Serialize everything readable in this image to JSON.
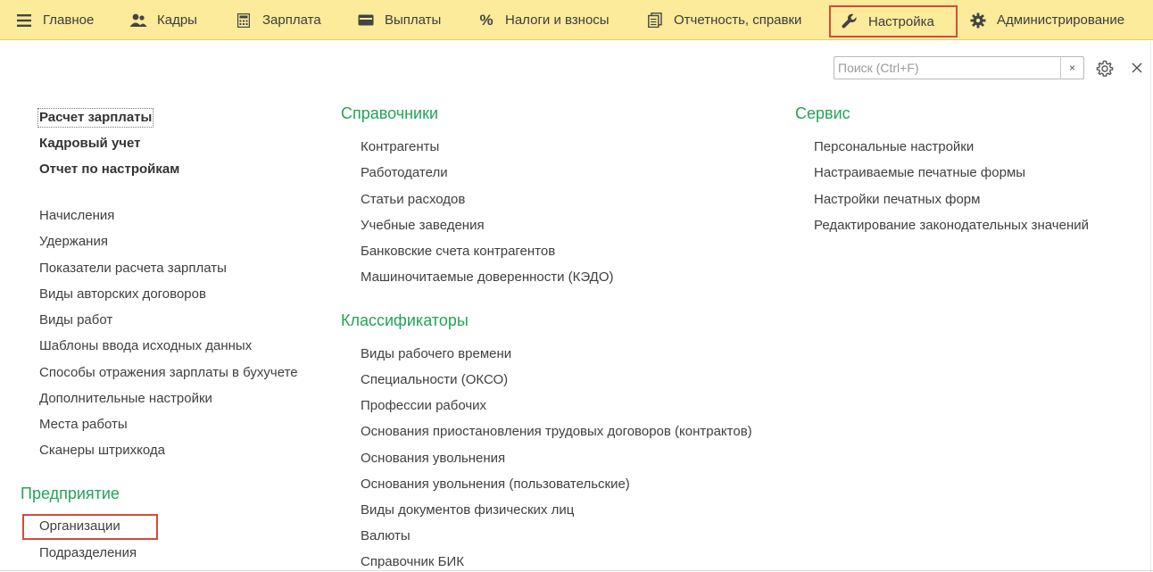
{
  "menu": {
    "tabs": [
      {
        "label": "Главное",
        "icon": "hamburger-menu-icon"
      },
      {
        "label": "Кадры",
        "icon": "people-icon"
      },
      {
        "label": "Зарплата",
        "icon": "calculator-icon"
      },
      {
        "label": "Выплаты",
        "icon": "wallet-icon"
      },
      {
        "label": "Налоги и взносы",
        "icon": "percent-icon"
      },
      {
        "label": "Отчетность, справки",
        "icon": "documents-icon"
      },
      {
        "label": "Настройка",
        "icon": "wrench-icon",
        "active": true
      },
      {
        "label": "Администрирование",
        "icon": "gear-icon"
      }
    ]
  },
  "search": {
    "placeholder": "Поиск (Ctrl+F)",
    "value": "",
    "clear_label": "×"
  },
  "left": {
    "bold_items": [
      "Расчет зарплаты",
      "Кадровый учет",
      "Отчет по настройкам"
    ],
    "items": [
      "Начисления",
      "Удержания",
      "Показатели расчета зарплаты",
      "Виды авторских договоров",
      "Виды работ",
      "Шаблоны ввода исходных данных",
      "Способы отражения зарплаты в бухучете",
      "Дополнительные настройки",
      "Места работы",
      "Сканеры штрихкода"
    ],
    "enterprise": {
      "title": "Предприятие",
      "items": [
        "Организации",
        "Подразделения"
      ]
    }
  },
  "middle": {
    "directories": {
      "title": "Справочники",
      "items": [
        "Контрагенты",
        "Работодатели",
        "Статьи расходов",
        "Учебные заведения",
        "Банковские счета контрагентов",
        "Машиночитаемые доверенности (КЭДО)"
      ]
    },
    "classifiers": {
      "title": "Классификаторы",
      "items": [
        "Виды рабочего времени",
        "Специальности (ОКСО)",
        "Профессии рабочих",
        "Основания приостановления трудовых договоров (контрактов)",
        "Основания увольнения",
        "Основания увольнения (пользовательские)",
        "Виды документов физических лиц",
        "Валюты",
        "Справочник БИК"
      ]
    }
  },
  "right": {
    "service": {
      "title": "Сервис",
      "items": [
        "Персональные настройки",
        "Настраиваемые печатные формы",
        "Настройки печатных форм",
        "Редактирование законодательных значений"
      ]
    }
  },
  "colors": {
    "menu_bg": "#fbeb9a",
    "section_green": "#23a455",
    "highlight_red": "#d34b3c"
  }
}
